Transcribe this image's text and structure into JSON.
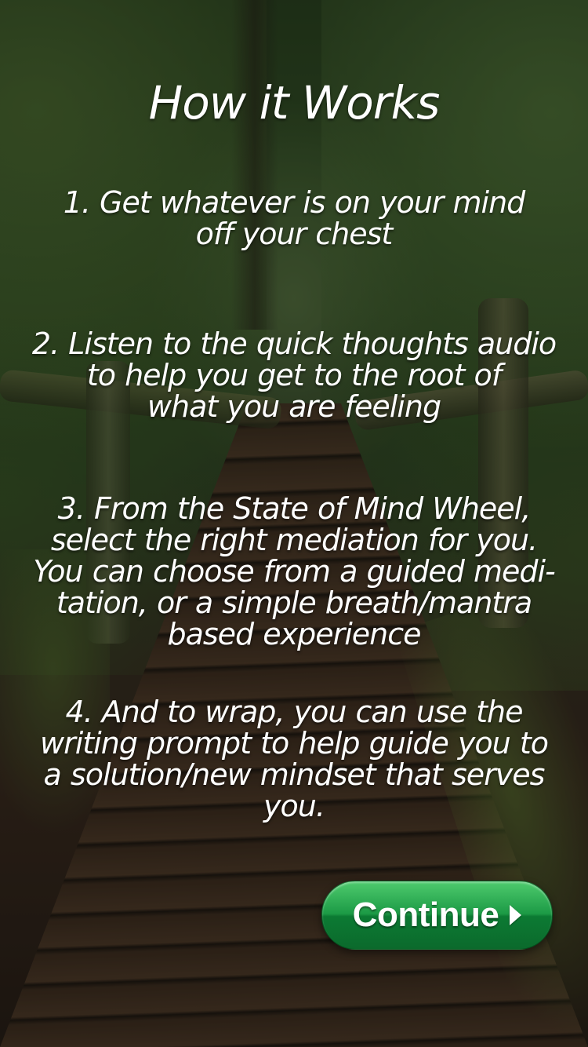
{
  "screen": {
    "title": "How it Works",
    "steps": [
      {
        "lines": [
          "1. Get whatever is on your mind",
          "off your chest"
        ]
      },
      {
        "lines": [
          "2.  Listen to the quick thoughts audio",
          "to help you get to the root of",
          "what you are feeling"
        ]
      },
      {
        "lines": [
          "3. From the State of Mind Wheel,",
          "select the right mediation for you.",
          "You can choose from a guided medi-",
          "tation, or a simple breath/mantra",
          "based experience"
        ]
      },
      {
        "lines": [
          "4. And to wrap, you can use the",
          "writing prompt to help guide you to",
          "a solution/new mindset that serves",
          "you."
        ]
      }
    ]
  },
  "continue_button": {
    "label": "Continue",
    "icon": "chevron-right-icon",
    "color": "#1c9a45"
  }
}
